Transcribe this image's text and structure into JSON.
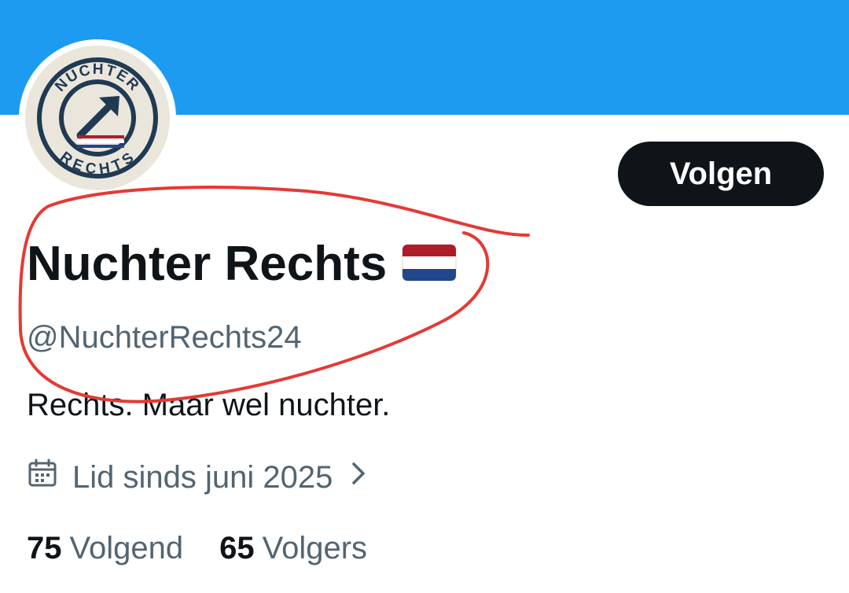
{
  "profile": {
    "display_name": "Nuchter Rechts",
    "handle": "@NuchterRechts24",
    "bio": "Rechts. Maar wel nuchter.",
    "joined": "Lid sinds juni 2025",
    "follow_label": "Volgen",
    "avatar_top_text": "NUCHTER",
    "avatar_bottom_text": "RECHTS",
    "flag_icon": "netherlands-flag-icon"
  },
  "stats": {
    "following_count": "75",
    "following_label": "Volgend",
    "followers_count": "65",
    "followers_label": "Volgers"
  },
  "colors": {
    "banner": "#1d9bf0",
    "text_primary": "#0f1419",
    "text_secondary": "#536471",
    "button": "#0f1419",
    "annotation": "#e53935",
    "avatar_background": "#ebe6dc",
    "avatar_navy": "#1f3a52",
    "flag_red": "#ae1c28",
    "flag_blue": "#21468b"
  }
}
